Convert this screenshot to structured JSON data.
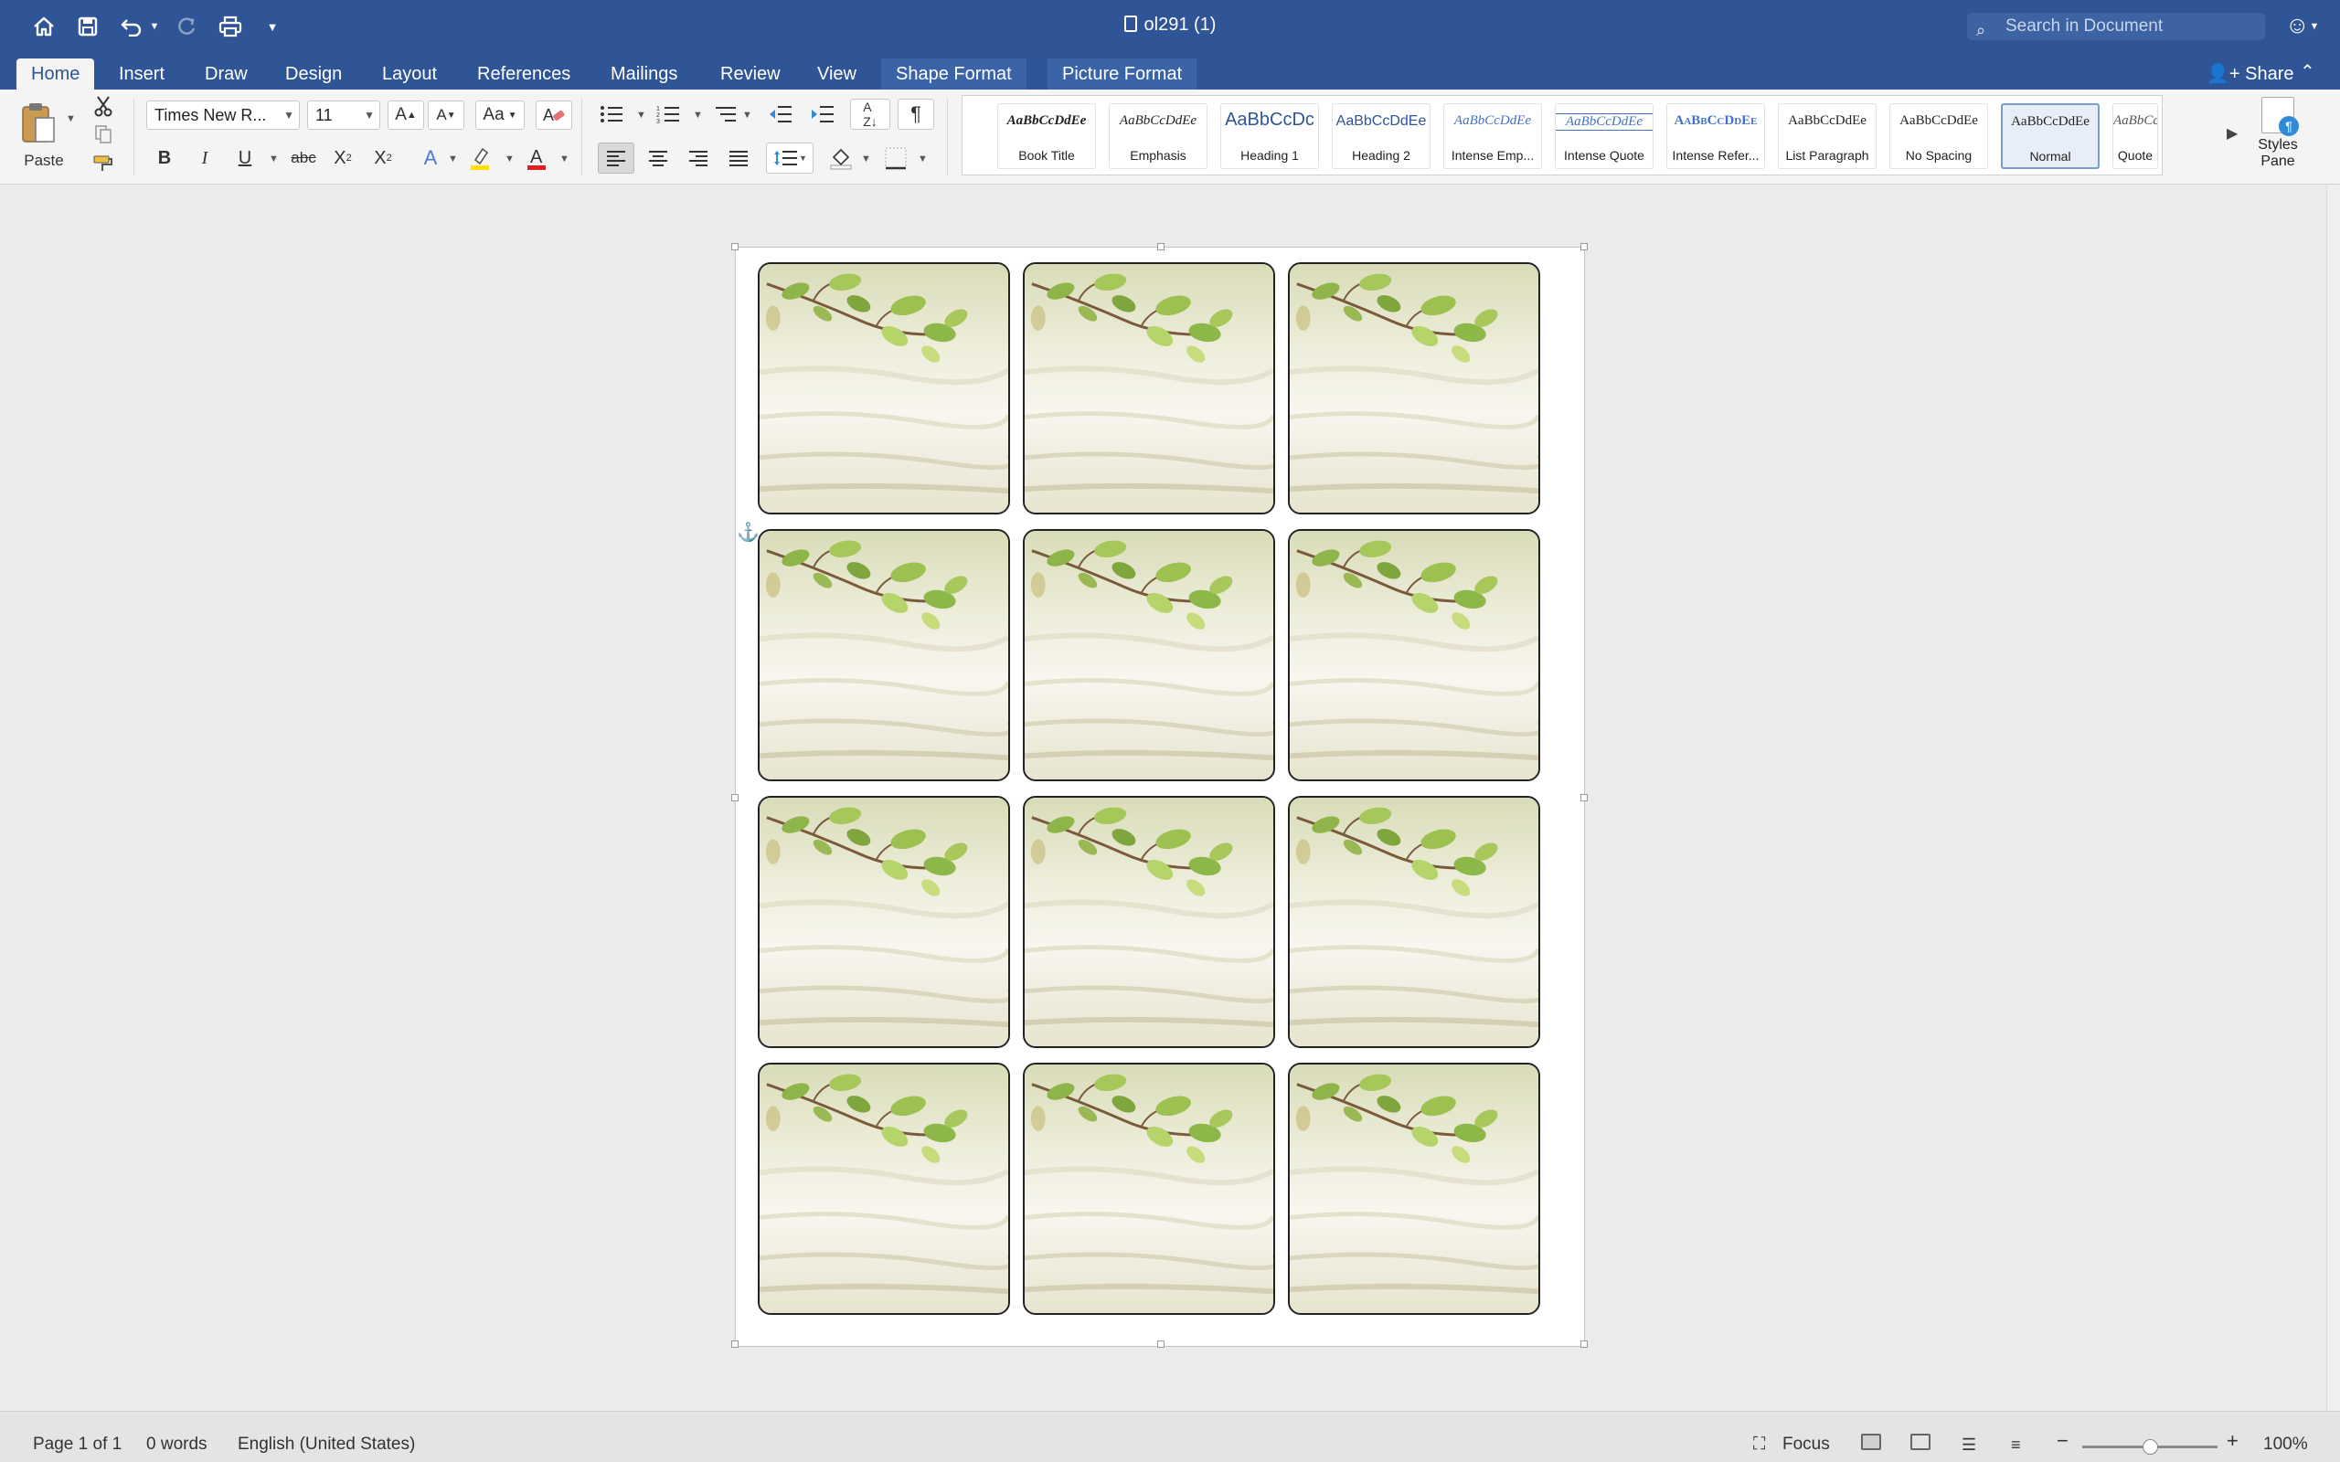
{
  "titlebar": {
    "doc_title": "ol291 (1)",
    "search_placeholder": "Search in Document",
    "quick_access": [
      "home-icon",
      "save-icon",
      "undo-icon",
      "redo-icon",
      "print-icon",
      "customize-icon"
    ]
  },
  "tabs": [
    {
      "label": "Home",
      "active": true
    },
    {
      "label": "Insert"
    },
    {
      "label": "Draw"
    },
    {
      "label": "Design"
    },
    {
      "label": "Layout"
    },
    {
      "label": "References"
    },
    {
      "label": "Mailings"
    },
    {
      "label": "Review"
    },
    {
      "label": "View"
    },
    {
      "label": "Shape Format",
      "contextual": true
    },
    {
      "label": "Picture Format",
      "contextual": true
    }
  ],
  "share_label": "Share",
  "ribbon": {
    "paste_label": "Paste",
    "font_name": "Times New R...",
    "font_size": "11",
    "bold": "B",
    "italic": "I",
    "underline": "U",
    "strikethrough": "abc",
    "subscript": "X",
    "superscript": "X",
    "font_color": "#e02020",
    "highlight_color": "#ffe000"
  },
  "styles": [
    {
      "sample": "AaBbCcDdEe",
      "name": "Book Title"
    },
    {
      "sample": "AaBbCcDdEe",
      "name": "Emphasis"
    },
    {
      "sample": "AaBbCcDc",
      "name": "Heading 1"
    },
    {
      "sample": "AaBbCcDdEe",
      "name": "Heading 2"
    },
    {
      "sample": "AaBbCcDdEe",
      "name": "Intense Emp..."
    },
    {
      "sample": "AaBbCcDdEe",
      "name": "Intense Quote"
    },
    {
      "sample": "AaBbCcDdEe",
      "name": "Intense Refer..."
    },
    {
      "sample": "AaBbCcDdEe",
      "name": "List Paragraph"
    },
    {
      "sample": "AaBbCcDdEe",
      "name": "No Spacing"
    },
    {
      "sample": "AaBbCcDdEe",
      "name": "Normal",
      "selected": true
    },
    {
      "sample": "AaBbCcDdEe",
      "name": "Quote"
    }
  ],
  "styles_pane_label": "Styles Pane",
  "document": {
    "label_rows": 4,
    "label_cols": 3
  },
  "status": {
    "page": "Page 1 of 1",
    "words": "0 words",
    "language": "English (United States)",
    "focus_label": "Focus",
    "zoom": "100%",
    "zoom_fraction": 0.5
  },
  "colors": {
    "accent": "#2f5597"
  }
}
